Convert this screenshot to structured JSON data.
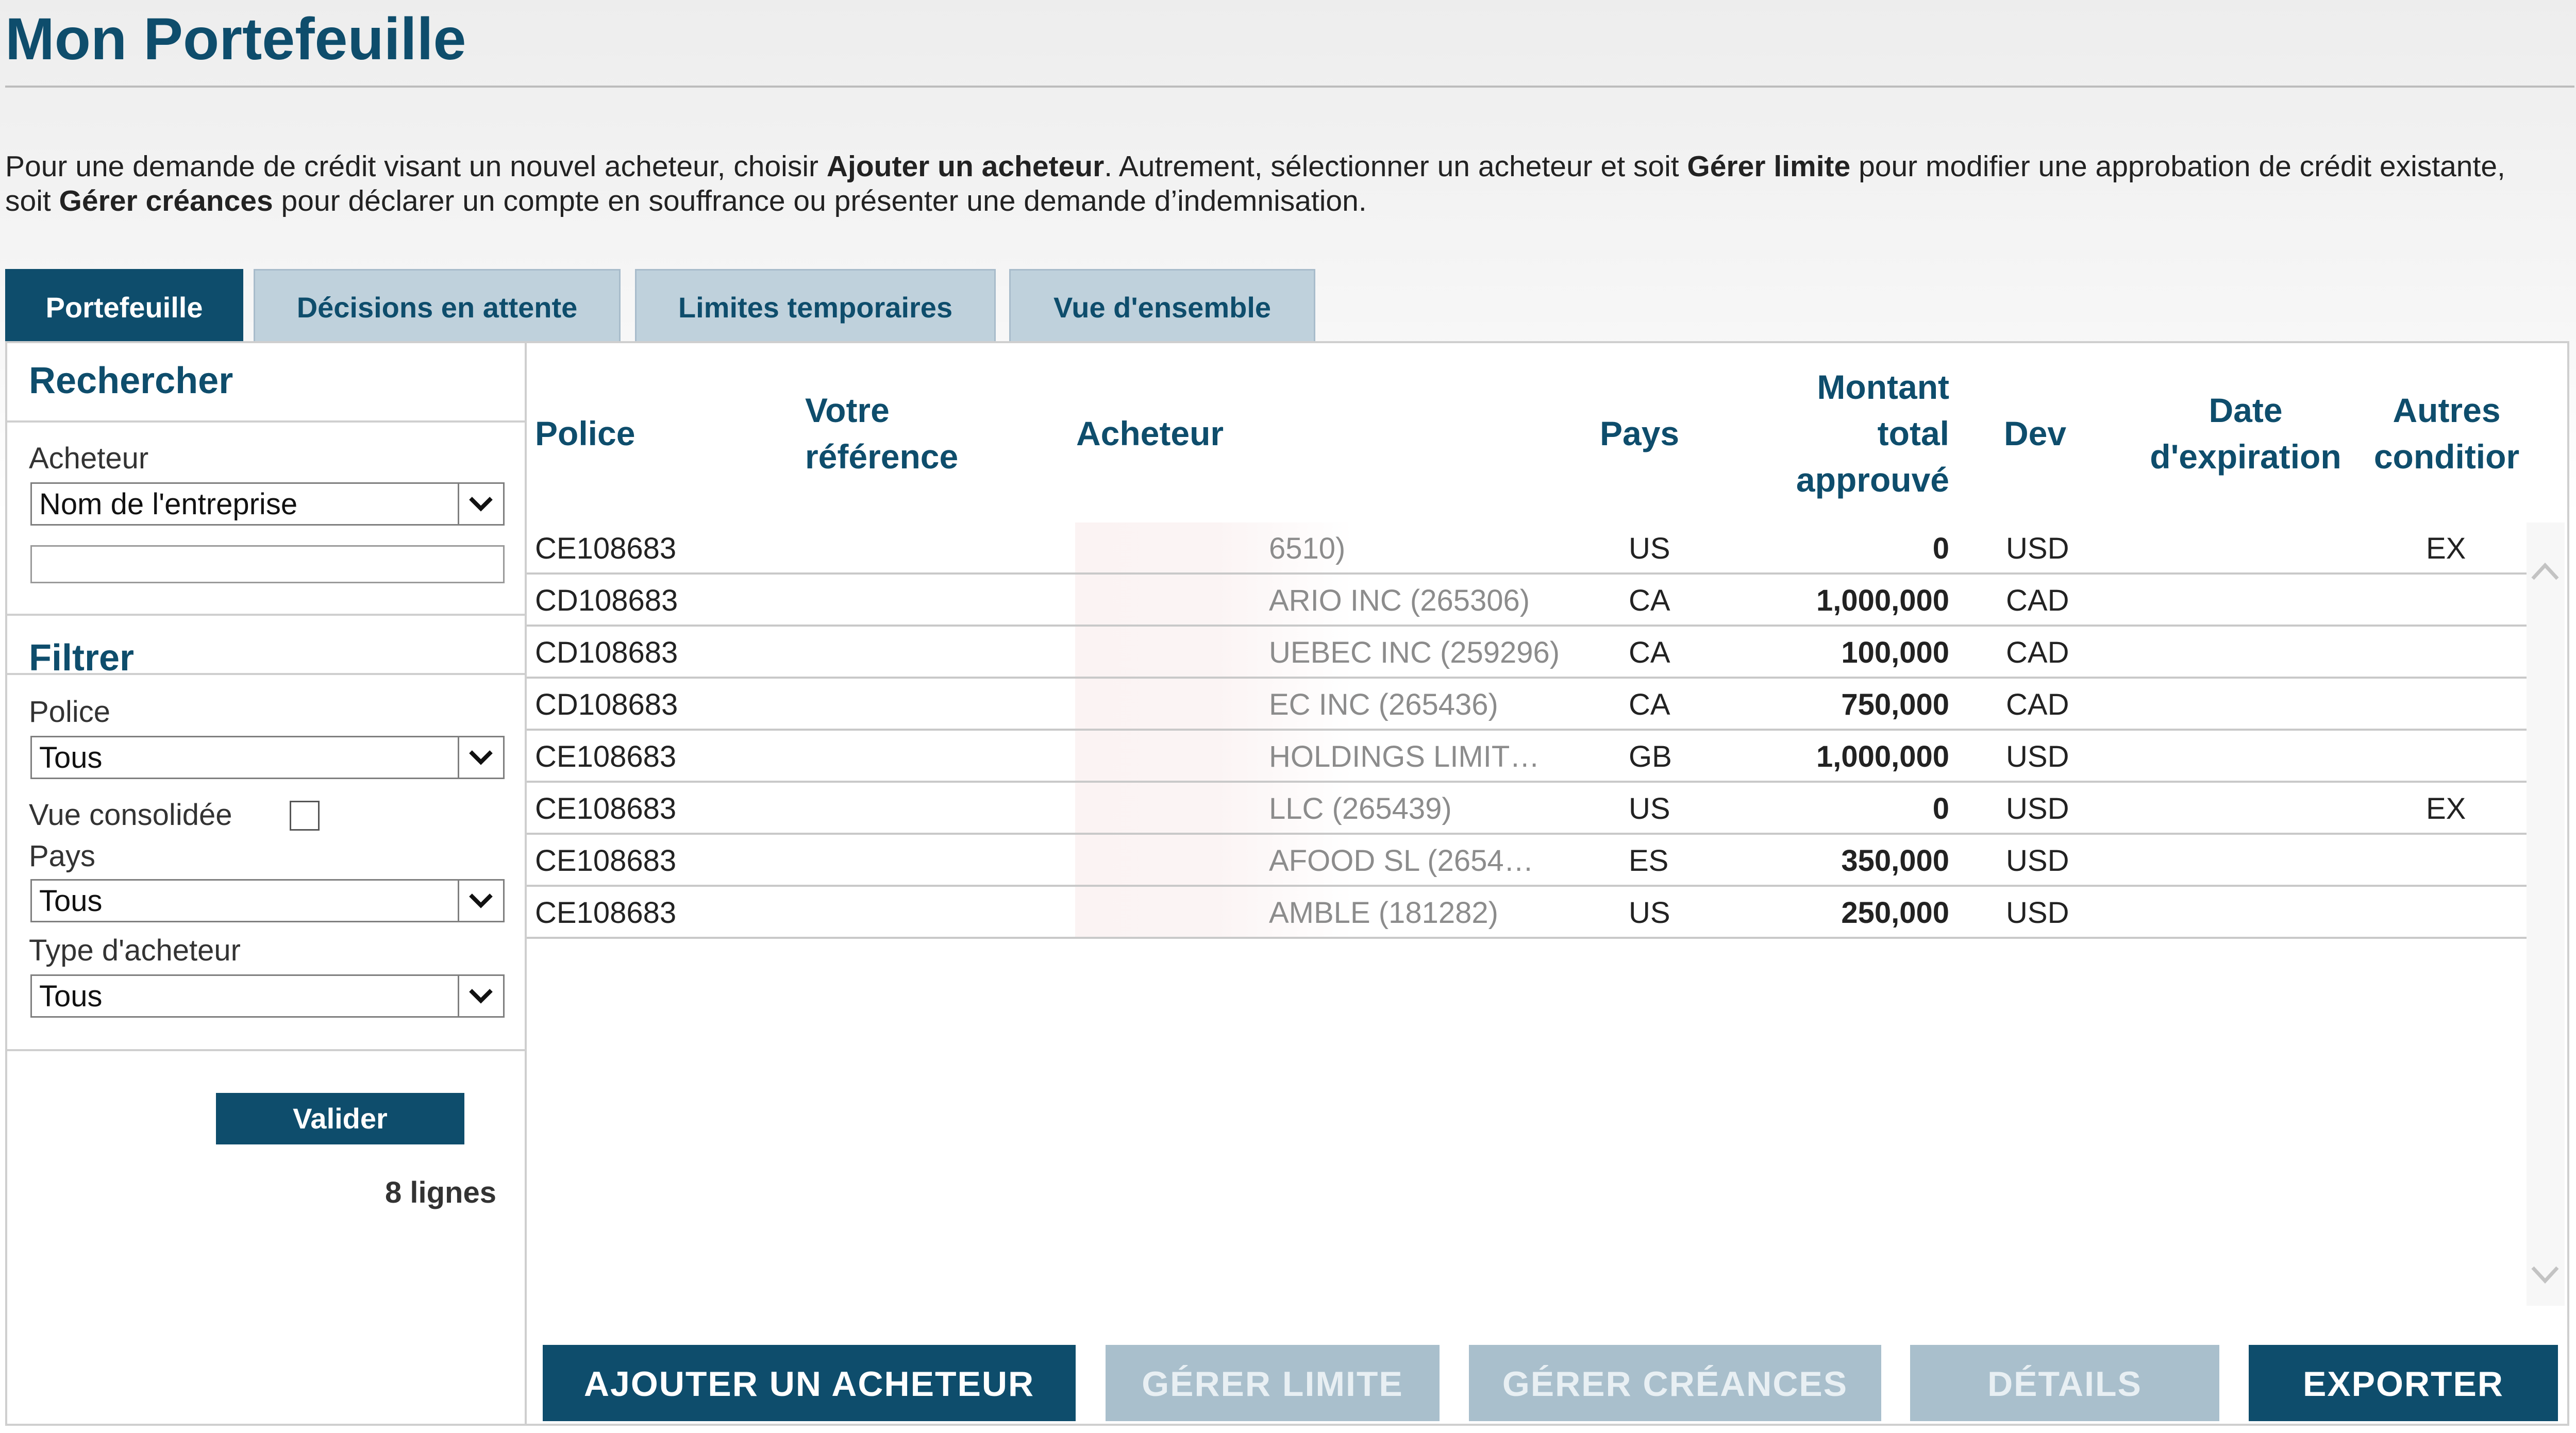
{
  "page": {
    "title": "Mon Portefeuille",
    "intro": {
      "p1": "Pour une demande de crédit visant un nouvel acheteur, choisir ",
      "b1": "Ajouter un acheteur",
      "p2": ". Autrement, sélectionner un acheteur et soit ",
      "b2": "Gérer limite",
      "p3": " pour modifier une approbation de crédit existante, soit ",
      "b3": "Gérer créances",
      "p4": " pour déclarer un compte en souffrance ou présenter une demande d’indemnisation."
    }
  },
  "tabs": [
    {
      "label": "Portefeuille",
      "active": true
    },
    {
      "label": "Décisions en attente",
      "active": false
    },
    {
      "label": "Limites temporaires",
      "active": false
    },
    {
      "label": "Vue d'ensemble",
      "active": false
    }
  ],
  "sidebar": {
    "search_heading": "Rechercher",
    "buyer_label": "Acheteur",
    "buyer_select": "Nom de l'entreprise",
    "buyer_input_value": "",
    "filter_heading": "Filtrer",
    "policy_label": "Police",
    "policy_select": "Tous",
    "consolidated_label": "Vue consolidée",
    "consolidated_checked": false,
    "country_label": "Pays",
    "country_select": "Tous",
    "buyer_type_label": "Type d'acheteur",
    "buyer_type_select": "Tous",
    "submit_label": "Valider",
    "row_count": "8 lignes"
  },
  "table": {
    "headers": {
      "police": "Police",
      "reference": "Votre\nréférence",
      "buyer": "Acheteur",
      "country": "Pays",
      "amount": "Montant\ntotal\napprouvé",
      "currency": "Dev",
      "expiry": "Date\nd'expiration",
      "other": "Autres\nconditior"
    },
    "rows": [
      {
        "police": "CE108683",
        "reference": "",
        "buyer": "6510)",
        "country": "US",
        "amount": "0",
        "currency": "USD",
        "expiry": "",
        "other": "EX"
      },
      {
        "police": "CD108683",
        "reference": "",
        "buyer": "ARIO INC (265306)",
        "country": "CA",
        "amount": "1,000,000",
        "currency": "CAD",
        "expiry": "",
        "other": ""
      },
      {
        "police": "CD108683",
        "reference": "",
        "buyer": "UEBEC INC (259296)",
        "country": "CA",
        "amount": "100,000",
        "currency": "CAD",
        "expiry": "",
        "other": ""
      },
      {
        "police": "CD108683",
        "reference": "",
        "buyer": "EC INC (265436)",
        "country": "CA",
        "amount": "750,000",
        "currency": "CAD",
        "expiry": "",
        "other": ""
      },
      {
        "police": "CE108683",
        "reference": "",
        "buyer": "HOLDINGS LIMIT…",
        "country": "GB",
        "amount": "1,000,000",
        "currency": "USD",
        "expiry": "",
        "other": ""
      },
      {
        "police": "CE108683",
        "reference": "",
        "buyer": "LLC (265439)",
        "country": "US",
        "amount": "0",
        "currency": "USD",
        "expiry": "",
        "other": "EX"
      },
      {
        "police": "CE108683",
        "reference": "",
        "buyer": "AFOOD SL (2654…",
        "country": "ES",
        "amount": "350,000",
        "currency": "USD",
        "expiry": "",
        "other": ""
      },
      {
        "police": "CE108683",
        "reference": "",
        "buyer": "AMBLE (181282)",
        "country": "US",
        "amount": "250,000",
        "currency": "USD",
        "expiry": "",
        "other": ""
      }
    ]
  },
  "actions": {
    "add_buyer": "AJOUTER UN ACHETEUR",
    "manage_limit": "GÉRER LIMITE",
    "manage_claims": "GÉRER CRÉANCES",
    "details": "DÉTAILS",
    "export": "EXPORTER"
  },
  "colors": {
    "brand": "#0e4d6c",
    "tab_inactive": "#bfd1dc",
    "button_disabled": "#a9bfcc"
  },
  "icons": {
    "select_arrow": "chevron-down-icon",
    "scroll_up": "chevron-up-icon",
    "scroll_down": "chevron-down-icon"
  }
}
